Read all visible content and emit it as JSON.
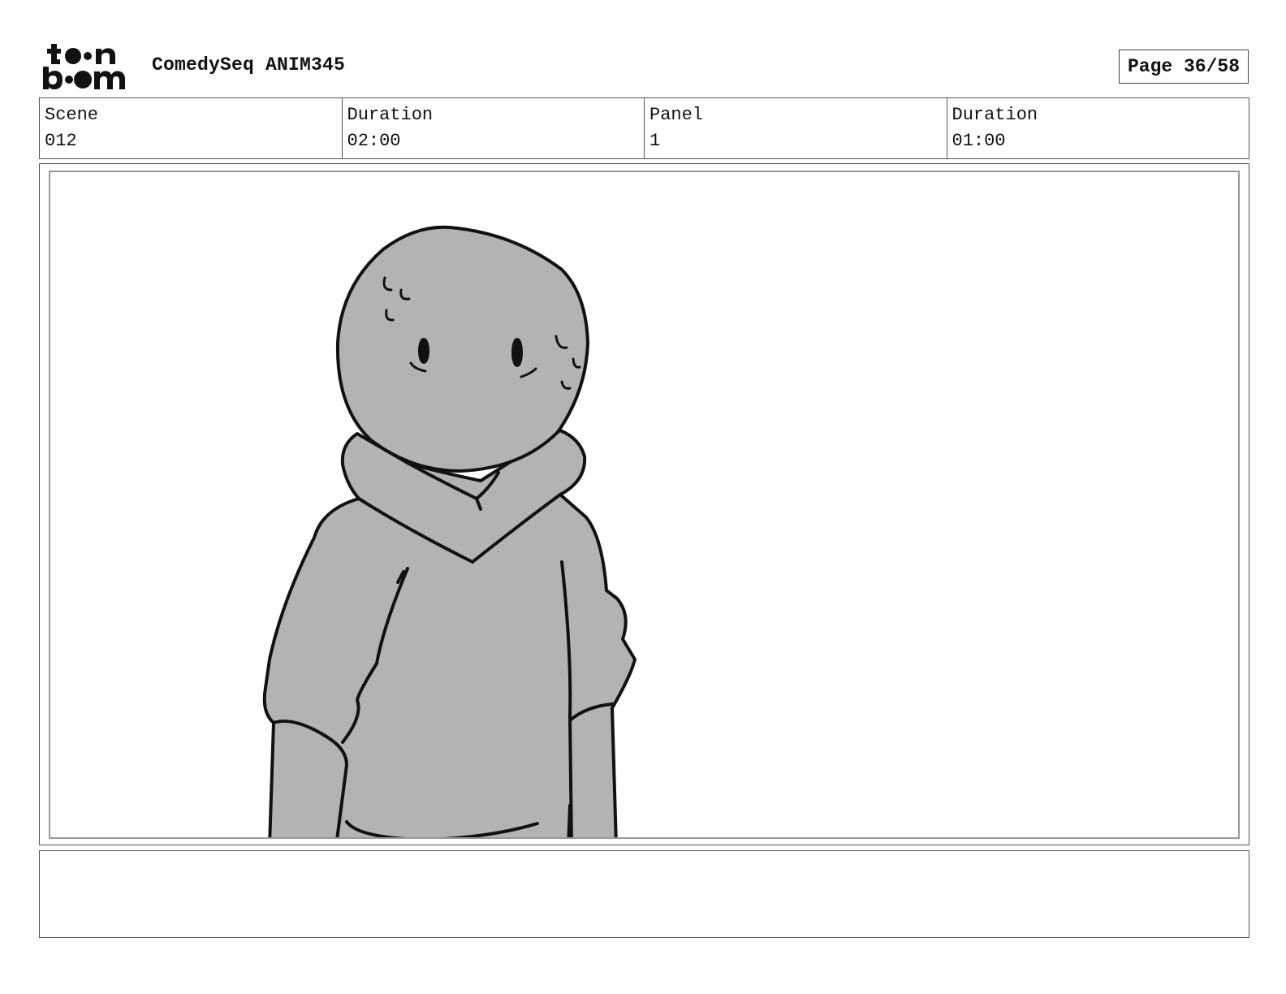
{
  "header": {
    "logo_name": "toon boom",
    "title": "ComedySeq ANIM345",
    "page_label": "Page 36/58"
  },
  "info": [
    {
      "label": "Scene",
      "value": "012"
    },
    {
      "label": "Duration",
      "value": "02:00"
    },
    {
      "label": "Panel",
      "value": "1"
    },
    {
      "label": "Duration",
      "value": "01:00"
    }
  ],
  "panel": {
    "image_name": "character-sketch",
    "fill_color": "#b3b3b3",
    "line_color": "#111111"
  },
  "notes": {
    "text": ""
  }
}
